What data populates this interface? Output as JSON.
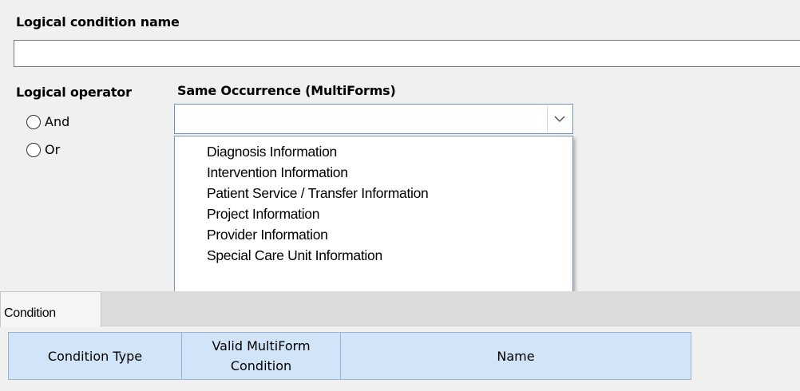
{
  "labels": {
    "condition_name": "Logical condition name",
    "logical_operator": "Logical operator",
    "same_occurrence": "Same Occurrence (MultiForms)"
  },
  "condition_name_field": {
    "value": ""
  },
  "operator_options": [
    "And",
    "Or"
  ],
  "combo": {
    "value": "",
    "options": [
      "Diagnosis Information",
      "Intervention Information",
      "Patient Service / Transfer Information",
      "Project Information",
      "Provider Information",
      "Special Care Unit Information"
    ]
  },
  "tabs": [
    {
      "label": "Condition"
    }
  ],
  "grid": {
    "columns": [
      "Condition Type",
      "Valid MultiForm Condition",
      "Name"
    ]
  },
  "icons": {
    "combo_button": "chevron-down-icon"
  }
}
